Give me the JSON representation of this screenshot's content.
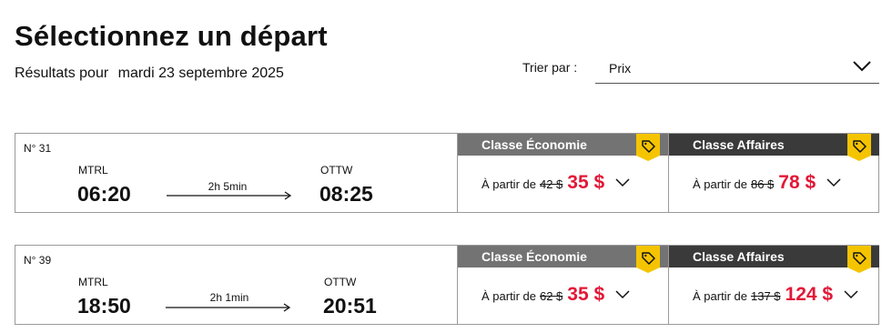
{
  "header": {
    "title": "Sélectionnez un départ",
    "results_label": "Résultats pour",
    "date": "mardi 23 septembre 2025"
  },
  "sort": {
    "label": "Trier par :",
    "value": "Prix"
  },
  "trips": [
    {
      "number": "N° 31",
      "origin": "MTRL",
      "departure": "06:20",
      "duration": "2h 5min",
      "destination": "OTTW",
      "arrival": "08:25",
      "economy": {
        "title": "Classe Économie",
        "from": "À partir de",
        "old_price": "42 $",
        "price": "35 $"
      },
      "business": {
        "title": "Classe Affaires",
        "from": "À partir de",
        "old_price": "86 $",
        "price": "78 $"
      }
    },
    {
      "number": "N° 39",
      "origin": "MTRL",
      "departure": "18:50",
      "duration": "2h 1min",
      "destination": "OTTW",
      "arrival": "20:51",
      "economy": {
        "title": "Classe Économie",
        "from": "À partir de",
        "old_price": "62 $",
        "price": "35 $"
      },
      "business": {
        "title": "Classe Affaires",
        "from": "À partir de",
        "old_price": "137 $",
        "price": "124 $"
      }
    }
  ],
  "colors": {
    "price_red": "#e31837",
    "economy_header": "#737373",
    "business_header": "#3a3a3a",
    "tag_yellow": "#f5c400"
  },
  "icons": {
    "tag": "price-tag-icon",
    "chevron": "chevron-down-icon",
    "arrow": "arrow-right-icon"
  }
}
